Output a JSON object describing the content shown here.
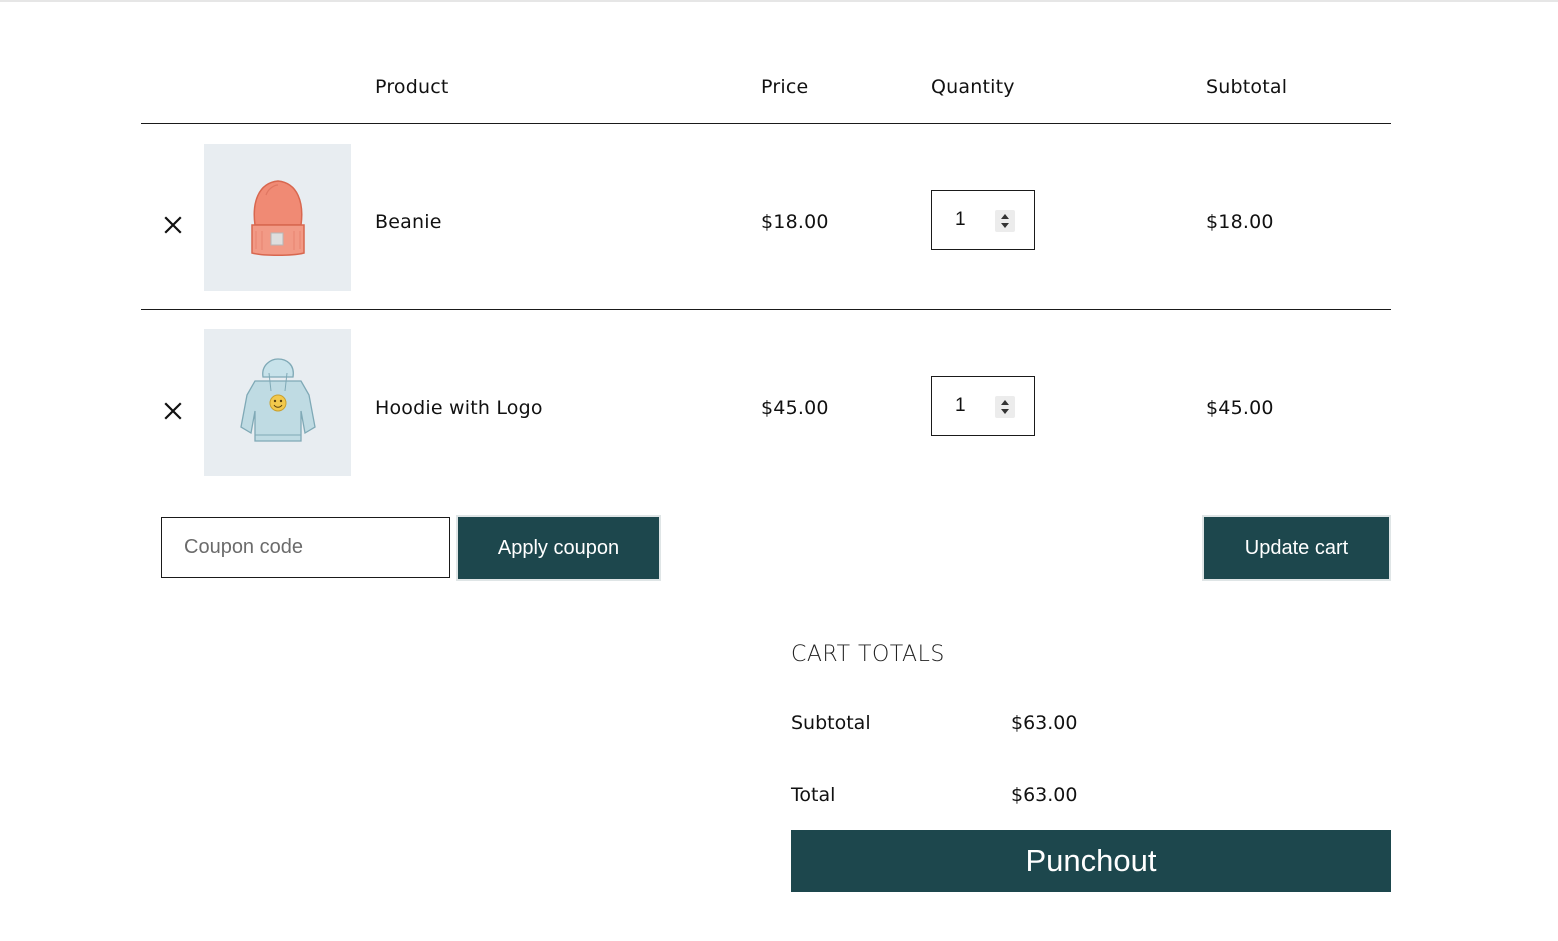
{
  "table": {
    "headers": {
      "product": "Product",
      "price": "Price",
      "quantity": "Quantity",
      "subtotal": "Subtotal"
    },
    "items": [
      {
        "name": "Beanie",
        "price": "$18.00",
        "quantity": "1",
        "subtotal": "$18.00",
        "thumbnail_icon": "beanie-icon"
      },
      {
        "name": "Hoodie with Logo",
        "price": "$45.00",
        "quantity": "1",
        "subtotal": "$45.00",
        "thumbnail_icon": "hoodie-icon"
      }
    ],
    "remove_icon": "close-icon"
  },
  "coupon": {
    "placeholder": "Coupon code",
    "apply_label": "Apply coupon"
  },
  "update_cart_label": "Update cart",
  "totals": {
    "title": "CART TOTALS",
    "subtotal_label": "Subtotal",
    "subtotal_value": "$63.00",
    "total_label": "Total",
    "total_value": "$63.00"
  },
  "punchout_label": "Punchout",
  "colors": {
    "accent": "#1d474d",
    "thumbnail_bg": "#e8edf1",
    "beanie": "#f08a74",
    "hoodie": "#bfdbe3"
  }
}
